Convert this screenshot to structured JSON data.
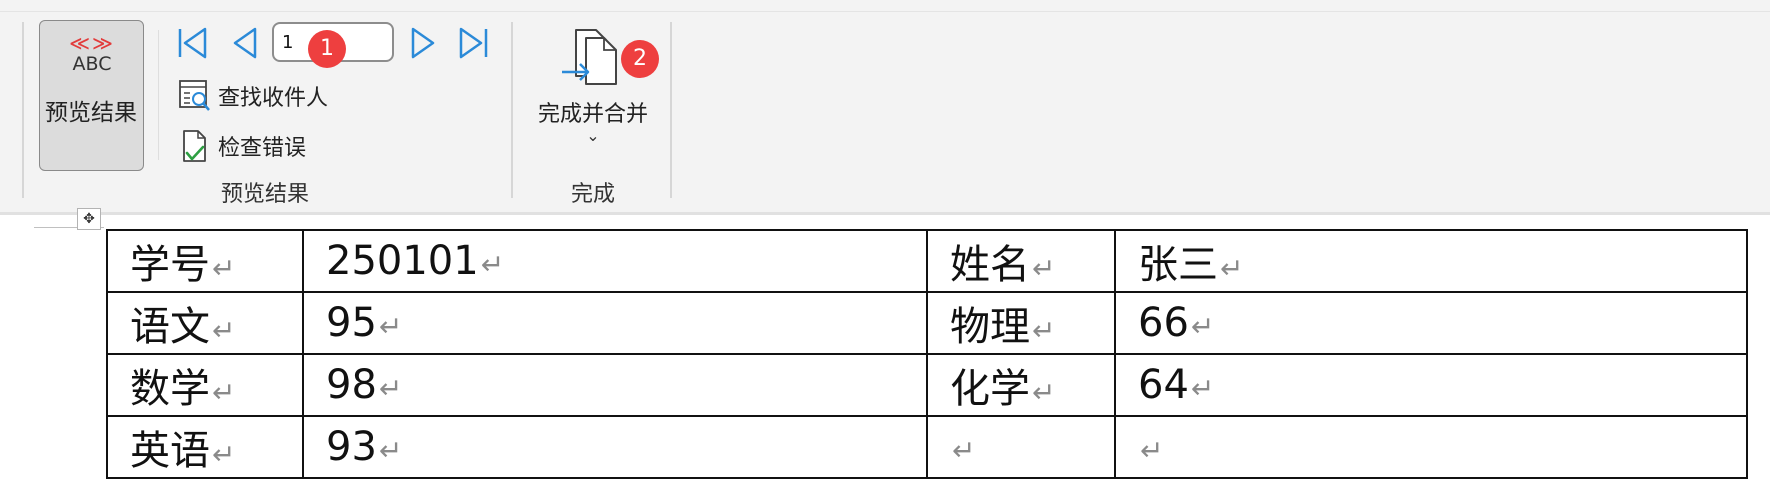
{
  "ribbon": {
    "preview_button": {
      "arrows": "≪≫",
      "abc": "ABC",
      "label": "预览结果"
    },
    "record_input": {
      "value": "1"
    },
    "find_recipient_label": "查找收件人",
    "check_errors_label": "检查错误",
    "preview_group_label": "预览结果",
    "finish_button": {
      "label": "完成并合并",
      "chevron": "⌄"
    },
    "finish_group_label": "完成",
    "badges": [
      "1",
      "2"
    ]
  },
  "document": {
    "table": [
      [
        "学号",
        "250101",
        "姓名",
        "张三"
      ],
      [
        "语文",
        "95",
        "物理",
        "66"
      ],
      [
        "数学",
        "98",
        "化学",
        "64"
      ],
      [
        "英语",
        "93",
        "",
        ""
      ]
    ],
    "paragraph_mark": "↵"
  },
  "colors": {
    "nav_blue": "#2b8ad8",
    "badge_red": "#ee3f3f",
    "arrow_red": "#e23b3b"
  }
}
